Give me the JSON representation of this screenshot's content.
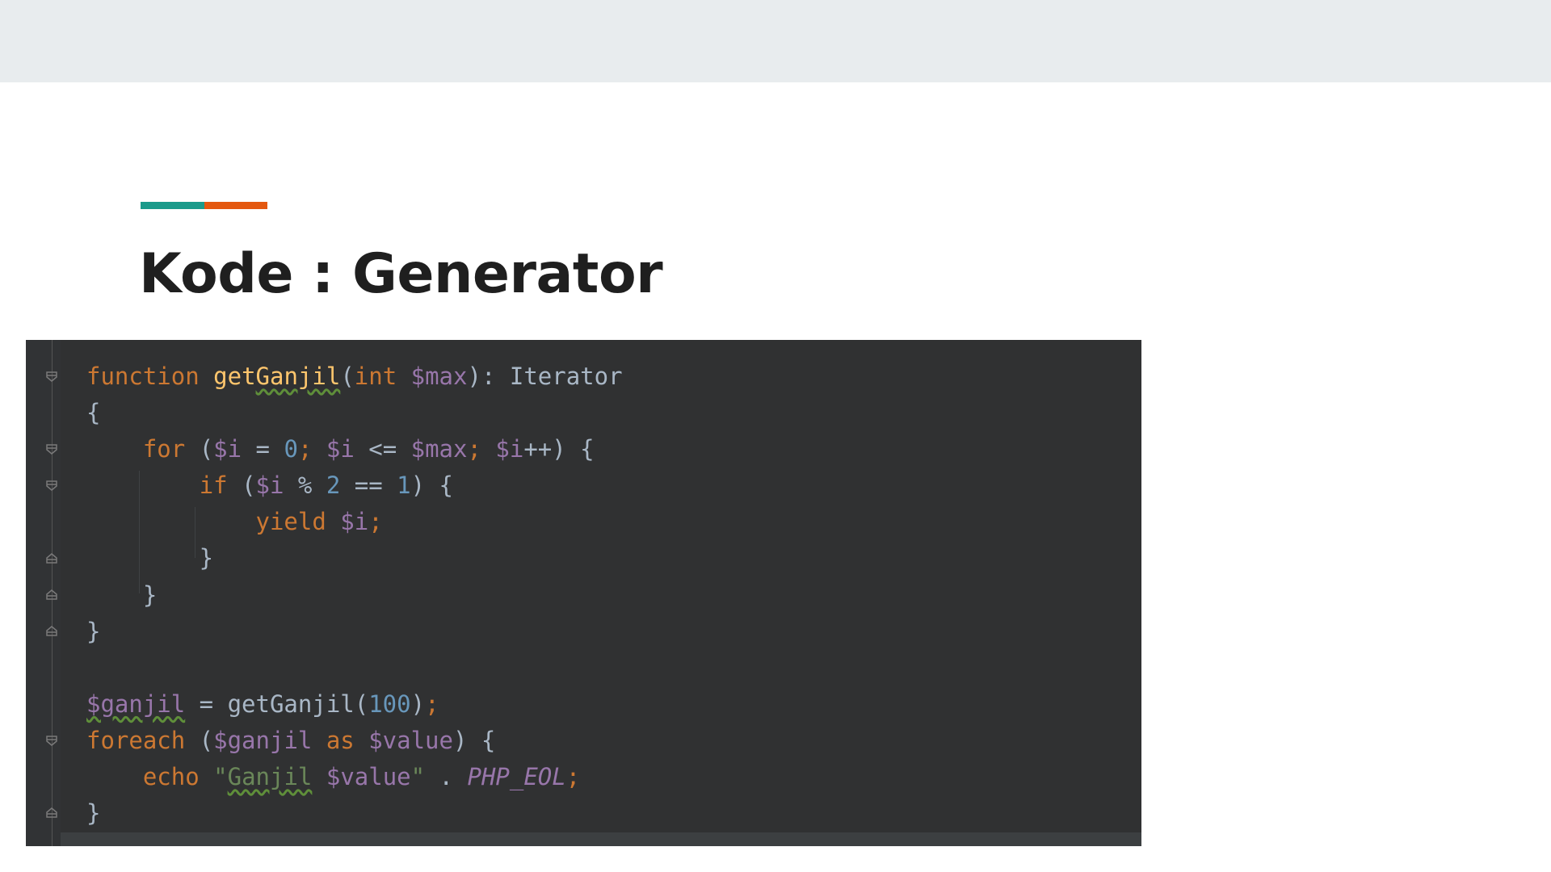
{
  "slide": {
    "title": "Kode : Generator",
    "accent_colors": [
      "#1a9a8a",
      "#e4570e"
    ]
  },
  "editor": {
    "theme_colors": {
      "background": "#2b2b2b",
      "keyword": "#cc7832",
      "function_name": "#ffc66d",
      "variable": "#9876aa",
      "number": "#6897bb",
      "string": "#6a8759",
      "plain": "#a9b7c6"
    },
    "fold_icons": [
      "fold-open-icon",
      "fold-open-icon",
      "fold-open-icon",
      "fold-close-icon",
      "fold-close-icon",
      "fold-close-icon",
      "fold-open-icon",
      "fold-close-icon"
    ],
    "code_lines": [
      [
        [
          "kw",
          "function"
        ],
        [
          "plain",
          " "
        ],
        [
          "fn",
          "getGanjil"
        ],
        [
          "plain",
          "("
        ],
        [
          "kw",
          "int"
        ],
        [
          "plain",
          " "
        ],
        [
          "var",
          "$max"
        ],
        [
          "plain",
          "): Iterator"
        ]
      ],
      [
        [
          "plain",
          "{"
        ]
      ],
      [
        [
          "plain",
          "    "
        ],
        [
          "kw",
          "for"
        ],
        [
          "plain",
          " ("
        ],
        [
          "var",
          "$i"
        ],
        [
          "plain",
          " = "
        ],
        [
          "num",
          "0"
        ],
        [
          "kw",
          ";"
        ],
        [
          "plain",
          " "
        ],
        [
          "var",
          "$i"
        ],
        [
          "plain",
          " <= "
        ],
        [
          "var",
          "$max"
        ],
        [
          "kw",
          ";"
        ],
        [
          "plain",
          " "
        ],
        [
          "var",
          "$i"
        ],
        [
          "plain",
          "++) {"
        ]
      ],
      [
        [
          "plain",
          "        "
        ],
        [
          "kw",
          "if"
        ],
        [
          "plain",
          " ("
        ],
        [
          "var",
          "$i"
        ],
        [
          "plain",
          " % "
        ],
        [
          "num",
          "2"
        ],
        [
          "plain",
          " == "
        ],
        [
          "num",
          "1"
        ],
        [
          "plain",
          ") {"
        ]
      ],
      [
        [
          "plain",
          "            "
        ],
        [
          "kw",
          "yield"
        ],
        [
          "plain",
          " "
        ],
        [
          "var",
          "$i"
        ],
        [
          "kw",
          ";"
        ]
      ],
      [
        [
          "plain",
          "        }"
        ]
      ],
      [
        [
          "plain",
          "    }"
        ]
      ],
      [
        [
          "plain",
          "}"
        ]
      ],
      [
        [
          "plain",
          ""
        ]
      ],
      [
        [
          "var",
          "$ganjil"
        ],
        [
          "plain",
          " = getGanjil("
        ],
        [
          "num",
          "100"
        ],
        [
          "plain",
          ")"
        ],
        [
          "kw",
          ";"
        ]
      ],
      [
        [
          "kw",
          "foreach"
        ],
        [
          "plain",
          " ("
        ],
        [
          "var",
          "$ganjil"
        ],
        [
          "plain",
          " "
        ],
        [
          "kw",
          "as"
        ],
        [
          "plain",
          " "
        ],
        [
          "var",
          "$value"
        ],
        [
          "plain",
          ") {"
        ]
      ],
      [
        [
          "plain",
          "    "
        ],
        [
          "kw",
          "echo"
        ],
        [
          "plain",
          " "
        ],
        [
          "str",
          "\"Ganjil "
        ],
        [
          "var",
          "$value"
        ],
        [
          "str",
          "\""
        ],
        [
          "plain",
          " . "
        ],
        [
          "konst",
          "PHP_EOL"
        ],
        [
          "kw",
          ";"
        ]
      ],
      [
        [
          "plain",
          "}"
        ]
      ]
    ]
  }
}
